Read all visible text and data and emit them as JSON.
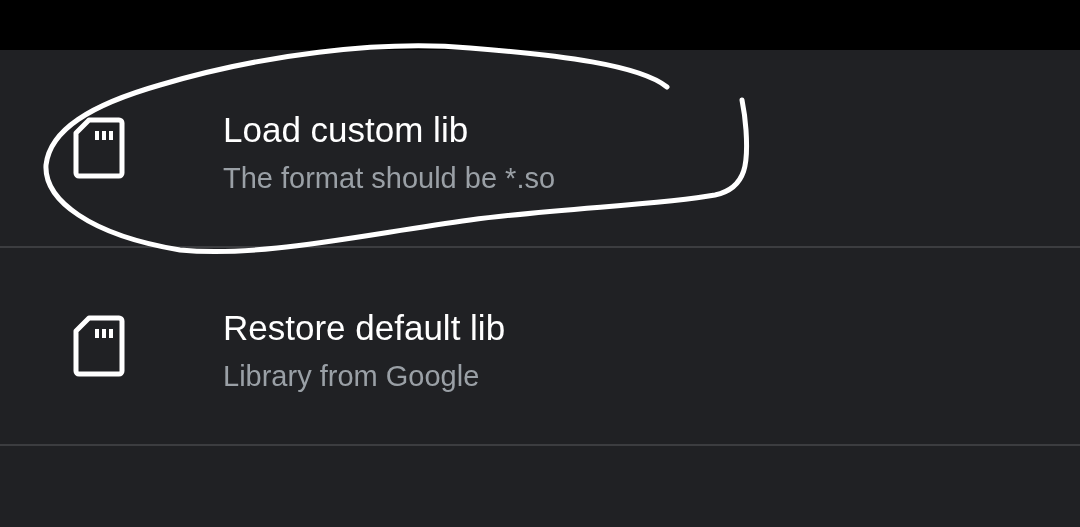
{
  "items": [
    {
      "title": "Load custom lib",
      "subtitle": "The format should be *.so"
    },
    {
      "title": "Restore default lib",
      "subtitle": "Library from Google"
    }
  ]
}
